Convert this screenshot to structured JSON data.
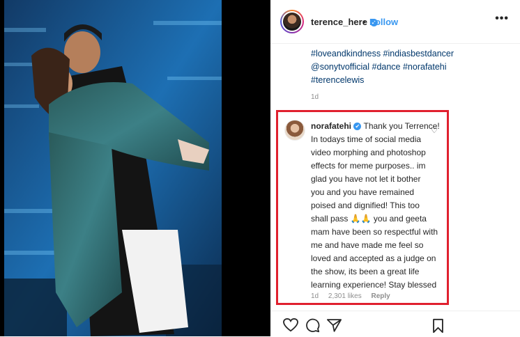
{
  "post": {
    "username": "terence_here",
    "follow_label": "Follow",
    "more_icon": "•••"
  },
  "caption": {
    "lines": [
      "#loveandkindness #indiasbestdancer",
      "@sonytvofficial #dance #norafatehi",
      "#terencelewis"
    ],
    "time": "1d"
  },
  "comment": {
    "username": "norafatehi",
    "lines": [
      "Thank you Terrence!",
      "In todays time of social media",
      "video morphing and photoshop",
      "effects for meme purposes.. im",
      "glad you have not let it bother",
      "you and you have remained",
      "poised and dignified! This too",
      "shall pass 🙏🙏 you and geeta",
      "mam have been so respectful with",
      "me and have made me feel so",
      "loved and accepted as a judge on",
      "the show, its been a great life",
      "learning experience! Stay blessed"
    ],
    "time": "1d",
    "likes": "2,301 likes",
    "reply_label": "Reply"
  },
  "icons": {
    "verified": "✔",
    "heart_small": "♡"
  },
  "colors": {
    "link": "#00376b",
    "accent": "#3897f0",
    "highlight_border": "#e0202e"
  }
}
